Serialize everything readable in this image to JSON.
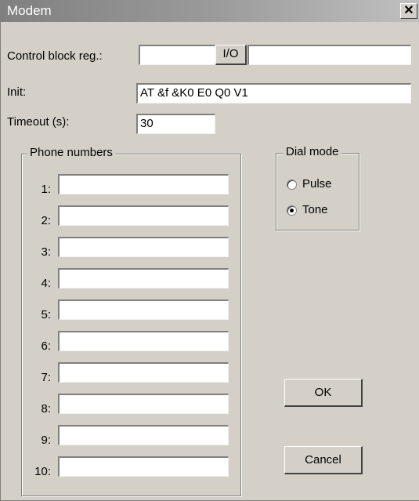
{
  "window": {
    "title": "Modem",
    "close_glyph": "✕"
  },
  "control_block": {
    "label": "Control block reg.:",
    "value_left": "",
    "io_label": "I/O",
    "value_right": ""
  },
  "init": {
    "label": "Init:",
    "value": "AT &f &K0 E0 Q0 V1"
  },
  "timeout": {
    "label": "Timeout (s):",
    "value": "30"
  },
  "phone_numbers": {
    "legend": "Phone numbers",
    "rows": [
      {
        "label": "1:",
        "value": ""
      },
      {
        "label": "2:",
        "value": ""
      },
      {
        "label": "3:",
        "value": ""
      },
      {
        "label": "4:",
        "value": ""
      },
      {
        "label": "5:",
        "value": ""
      },
      {
        "label": "6:",
        "value": ""
      },
      {
        "label": "7:",
        "value": ""
      },
      {
        "label": "8:",
        "value": ""
      },
      {
        "label": "9:",
        "value": ""
      },
      {
        "label": "10:",
        "value": ""
      }
    ]
  },
  "dial_mode": {
    "legend": "Dial mode",
    "options": [
      {
        "label": "Pulse",
        "selected": false
      },
      {
        "label": "Tone",
        "selected": true
      }
    ]
  },
  "buttons": {
    "ok": "OK",
    "cancel": "Cancel"
  }
}
